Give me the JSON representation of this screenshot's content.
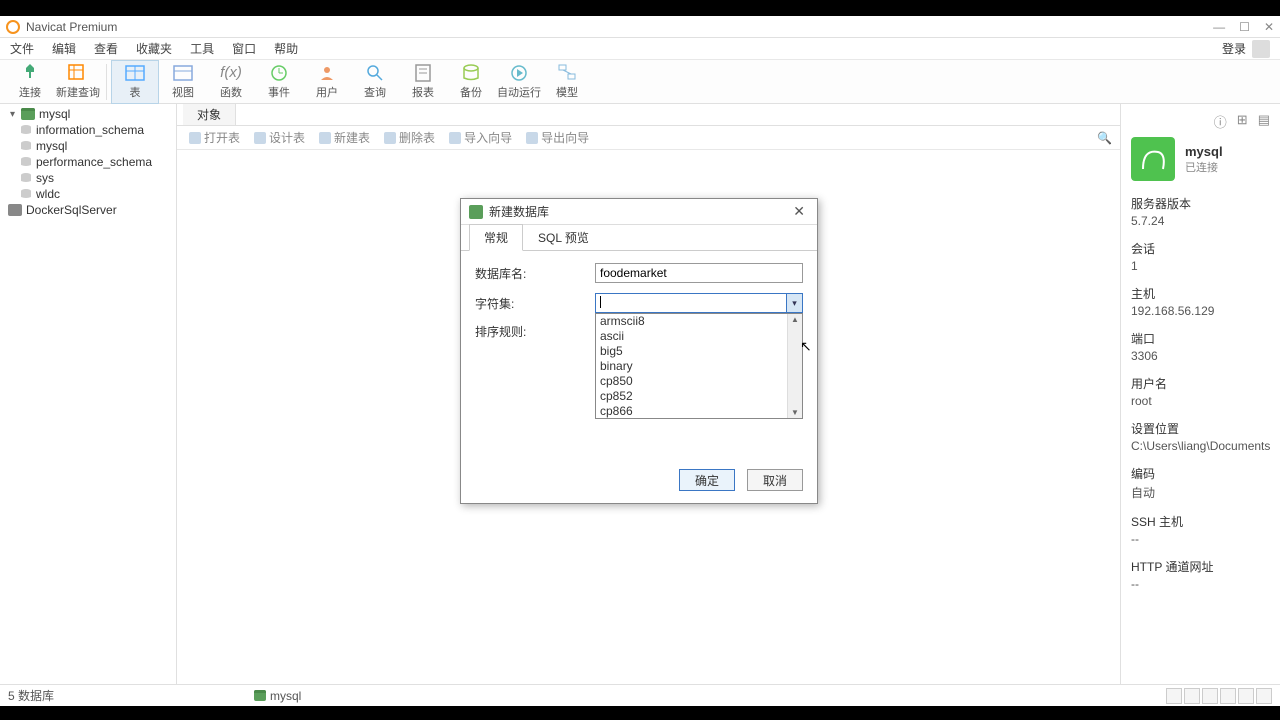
{
  "app": {
    "title": "Navicat Premium"
  },
  "menu": {
    "items": [
      "文件",
      "编辑",
      "查看",
      "收藏夹",
      "工具",
      "窗口",
      "帮助"
    ],
    "login": "登录"
  },
  "toolbar": [
    {
      "label": "连接",
      "icon": "plug"
    },
    {
      "label": "新建查询",
      "icon": "grid-plus"
    },
    {
      "label": "表",
      "icon": "table",
      "active": true
    },
    {
      "label": "视图",
      "icon": "view"
    },
    {
      "label": "函数",
      "icon": "fx"
    },
    {
      "label": "事件",
      "icon": "clock"
    },
    {
      "label": "用户",
      "icon": "user"
    },
    {
      "label": "查询",
      "icon": "search"
    },
    {
      "label": "报表",
      "icon": "report"
    },
    {
      "label": "备份",
      "icon": "backup"
    },
    {
      "label": "自动运行",
      "icon": "auto"
    },
    {
      "label": "模型",
      "icon": "model"
    }
  ],
  "tree": {
    "root": {
      "label": "mysql",
      "children": [
        "information_schema",
        "mysql",
        "performance_schema",
        "sys",
        "wldc"
      ]
    },
    "other": {
      "label": "DockerSqlServer"
    }
  },
  "content": {
    "tab": "对象",
    "subtoolbar": [
      "打开表",
      "设计表",
      "新建表",
      "删除表",
      "导入向导",
      "导出向导"
    ]
  },
  "dialog": {
    "title": "新建数据库",
    "tabs": [
      "常规",
      "SQL 预览"
    ],
    "fields": {
      "db_name_label": "数据库名:",
      "db_name_value": "foodemarket",
      "charset_label": "字符集:",
      "charset_value": "",
      "collation_label": "排序规则:"
    },
    "charset_options": [
      "armscii8",
      "ascii",
      "big5",
      "binary",
      "cp850",
      "cp852",
      "cp866"
    ],
    "ok": "确定",
    "cancel": "取消"
  },
  "panel": {
    "title": "mysql",
    "status": "已连接",
    "rows": [
      {
        "label": "服务器版本",
        "value": "5.7.24"
      },
      {
        "label": "会话",
        "value": "1"
      },
      {
        "label": "主机",
        "value": "192.168.56.129"
      },
      {
        "label": "端口",
        "value": "3306"
      },
      {
        "label": "用户名",
        "value": "root"
      },
      {
        "label": "设置位置",
        "value": "C:\\Users\\liang\\Documents\\Nav"
      },
      {
        "label": "编码",
        "value": "自动"
      },
      {
        "label": "SSH 主机",
        "value": "--"
      },
      {
        "label": "HTTP 通道网址",
        "value": "--"
      }
    ]
  },
  "statusbar": {
    "left": "5 数据库",
    "conn": "mysql"
  }
}
